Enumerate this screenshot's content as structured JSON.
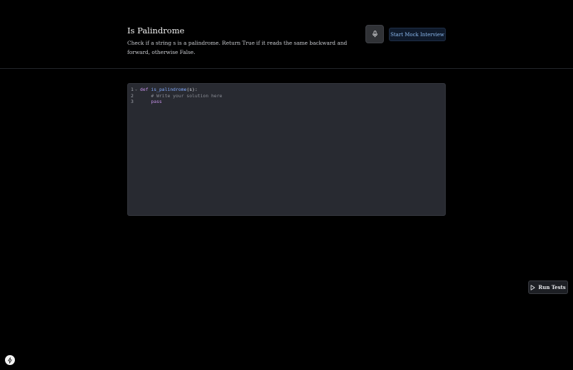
{
  "problem": {
    "title": "Is Palindrome",
    "description": "Check if a string s is a palindrome. Return True if it reads the same backward and forward, otherwise False."
  },
  "toolbar": {
    "mic_icon": "microphone-icon",
    "mock_interview_label": "Start Mock Interview"
  },
  "editor": {
    "lines": [
      {
        "number": "1",
        "tokens": [
          {
            "type": "kw",
            "text": "def"
          },
          {
            "type": "pn",
            "text": " "
          },
          {
            "type": "fn",
            "text": "is_palindrome"
          },
          {
            "type": "pn",
            "text": "(s):"
          }
        ]
      },
      {
        "number": "2",
        "tokens": [
          {
            "type": "pn",
            "text": "    "
          },
          {
            "type": "cm",
            "text": "# Write your solution here"
          }
        ]
      },
      {
        "number": "3",
        "tokens": [
          {
            "type": "pn",
            "text": "    "
          },
          {
            "type": "kw",
            "text": "pass"
          }
        ]
      }
    ],
    "run_label": "Run Tests",
    "run_icon": "play-icon"
  },
  "colors": {
    "background": "#000000",
    "editor_bg": "#282a31",
    "accent": "#8ab7ec",
    "keyword": "#c792ea",
    "function": "#82aaff",
    "comment": "#8a8d95"
  },
  "fab": {
    "icon": "lightning-icon"
  }
}
